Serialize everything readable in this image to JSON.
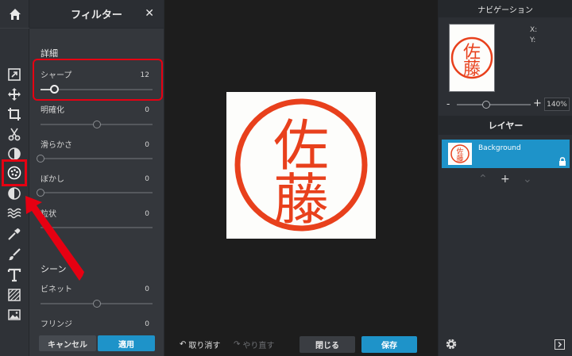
{
  "filter_panel": {
    "title": "フィルター",
    "section_detail": "詳細",
    "section_scene": "シーン",
    "filters": [
      {
        "label": "シャープ",
        "value": "12",
        "level": 0.12
      },
      {
        "label": "明確化",
        "value": "0",
        "level": 0.5
      },
      {
        "label": "滑らかさ",
        "value": "0",
        "level": 0.0
      },
      {
        "label": "ぼかし",
        "value": "0",
        "level": 0.0
      },
      {
        "label": "粒状",
        "value": "0",
        "level": 0.0
      }
    ],
    "scene_filters": [
      {
        "label": "ビネット",
        "value": "0",
        "level": 0.5
      },
      {
        "label": "フリンジ",
        "value": "0",
        "level": 0.0
      }
    ],
    "cancel_label": "キャンセル",
    "apply_label": "適用"
  },
  "canvas": {
    "stamp_text_top": "佐",
    "stamp_text_bottom": "藤"
  },
  "bottom_bar": {
    "undo_label": "取り消す",
    "redo_label": "やり直す",
    "close_label": "閉じる",
    "save_label": "保存"
  },
  "navigation": {
    "title": "ナビゲーション",
    "x_label": "X:",
    "y_label": "Y:",
    "zoom_minus": "-",
    "zoom_plus": "+",
    "zoom_value": "140%",
    "zoom_level": 0.4
  },
  "layers": {
    "title": "レイヤー",
    "items": [
      {
        "name": "Background",
        "selected": true
      }
    ]
  },
  "colors": {
    "accent": "#1e93c9",
    "annotation": "#e60012",
    "stamp": "#e8401c"
  },
  "toolbar": {
    "tools": [
      "home-icon",
      "adjust-icon",
      "move-icon",
      "crop-icon",
      "cut-icon",
      "exposure-icon",
      "filter-icon",
      "color-icon",
      "wave-icon",
      "dropper-icon",
      "brush-icon",
      "text-icon",
      "texture-icon",
      "image-icon"
    ]
  }
}
